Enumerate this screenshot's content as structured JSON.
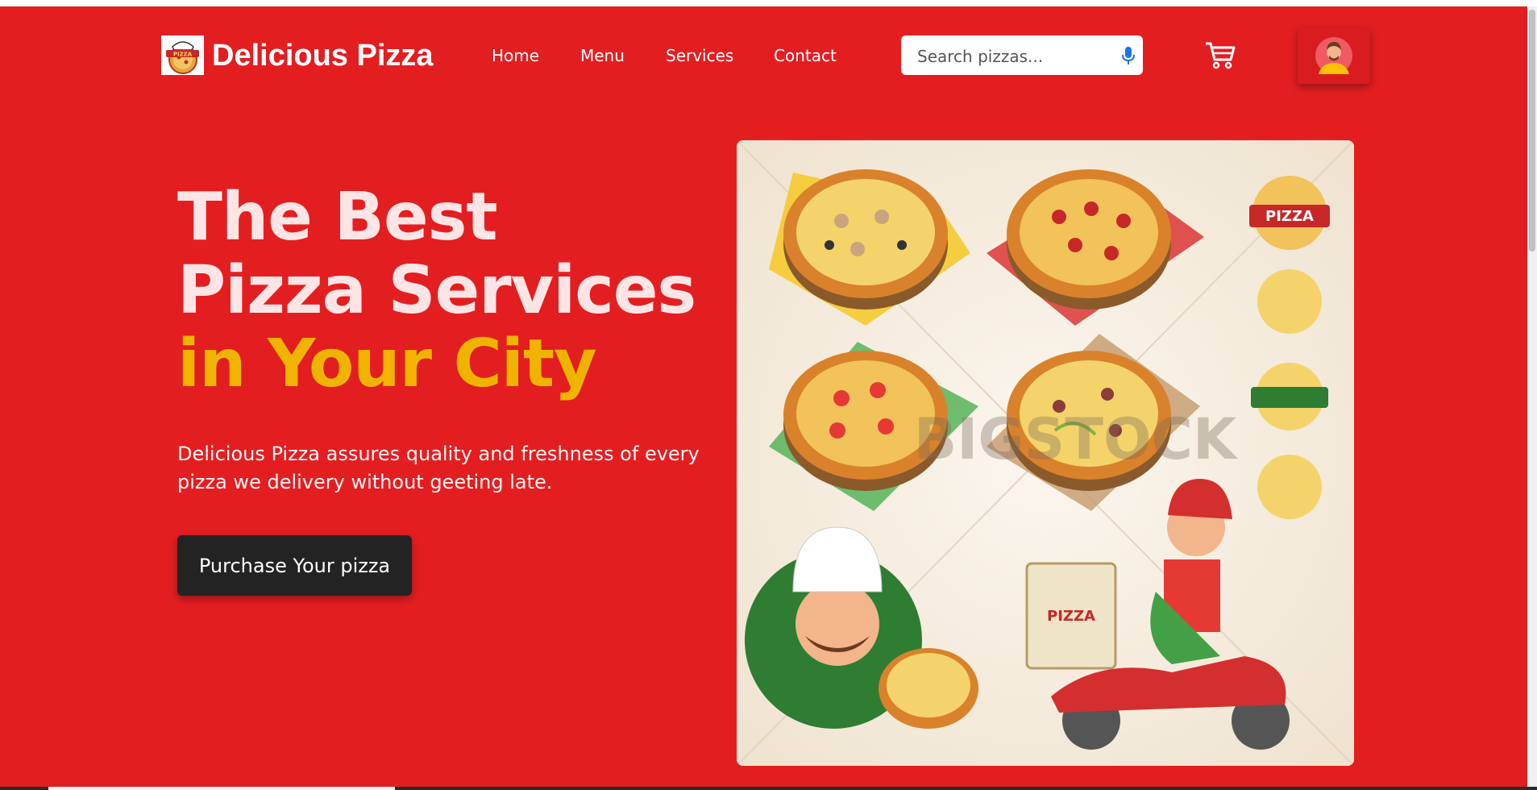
{
  "header": {
    "brand": "Delicious Pizza",
    "logo_text": "PIZZA",
    "nav": [
      "Home",
      "Menu",
      "Services",
      "Contact"
    ],
    "search": {
      "placeholder": "Search pizzas..."
    }
  },
  "hero": {
    "headline_line1": "The Best",
    "headline_line2": "Pizza Services",
    "headline_line3": "in Your City",
    "description": "Delicious Pizza assures quality and freshness of every pizza we delivery without geeting late.",
    "cta_label": "Purchase Your pizza",
    "image": {
      "badge_text": "PIZZA",
      "box_text": "PIZZA",
      "watermark": "BIGSTOCK"
    }
  },
  "icons": [
    "pizza-logo-icon",
    "microphone-icon",
    "cart-icon",
    "avatar-icon"
  ],
  "colors": {
    "background": "#e31e21",
    "accent_yellow": "#f0b400",
    "headline_light": "#fde4e5",
    "button_dark": "#232323"
  }
}
